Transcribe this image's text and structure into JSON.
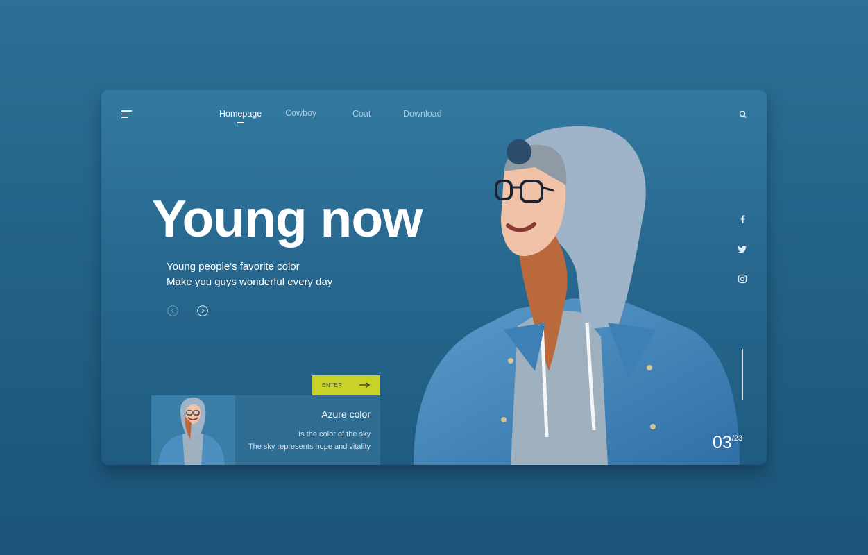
{
  "nav": {
    "items": [
      {
        "label": "Homepage",
        "active": true
      },
      {
        "label": "Cowboy",
        "active": false
      },
      {
        "label": "Coat",
        "active": false
      },
      {
        "label": "Download",
        "active": false
      }
    ]
  },
  "hero": {
    "title": "Young now",
    "subtitle_line1": "Young people's favorite color",
    "subtitle_line2": "Make you guys wonderful every day"
  },
  "feature": {
    "enter_label": "ENTER",
    "title": "Azure color",
    "line1": "Is the color of the sky",
    "line2": "The sky represents hope and vitality"
  },
  "pager": {
    "current": "03",
    "total": "/23"
  },
  "social": [
    "facebook-icon",
    "twitter-icon",
    "instagram-icon"
  ],
  "colors": {
    "accent": "#c9d22a",
    "background": "#266890",
    "text": "#ffffff"
  }
}
